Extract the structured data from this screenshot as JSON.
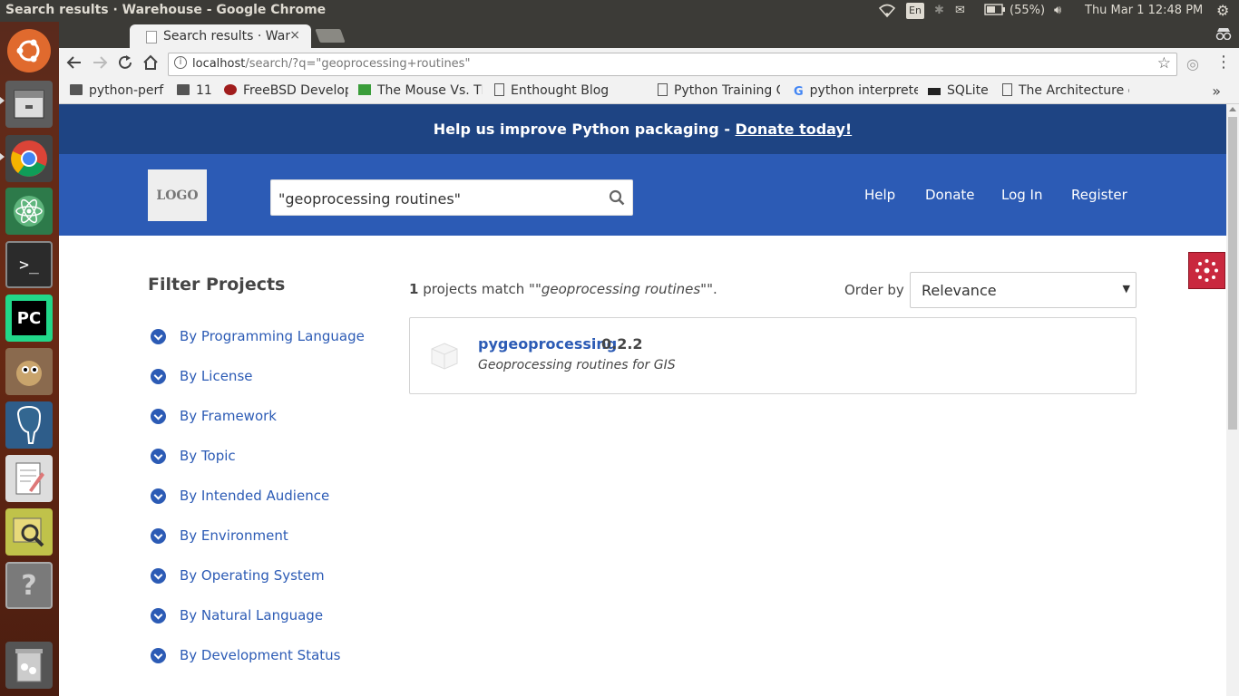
{
  "os": {
    "window_title": "Search results · Warehouse - Google Chrome",
    "keyboard": "En",
    "battery": "(55%)",
    "clock": "Thu Mar  1 12:48 PM"
  },
  "browser": {
    "tab_title": "Search results · Warehouse",
    "tab_close": "×",
    "url_host": "localhost",
    "url_path": "/search/?q=\"geoprocessing+routines\"",
    "bookmarks": [
      {
        "label": "python-perf",
        "icon": "folder-icon"
      },
      {
        "label": "11",
        "icon": "folder-icon"
      },
      {
        "label": "FreeBSD Developers' H",
        "icon": "freebsd-icon"
      },
      {
        "label": "The Mouse Vs. The Pyt",
        "icon": "python-icon"
      },
      {
        "label": "Enthought Blog",
        "icon": "page-icon"
      },
      {
        "label": "Python Training Cours",
        "icon": "page-icon"
      },
      {
        "label": "python interpreter - W",
        "icon": "google-icon"
      },
      {
        "label": "SQLite",
        "icon": "sqlite-icon"
      },
      {
        "label": "The Architecture of Op",
        "icon": "page-icon"
      }
    ],
    "bookmarks_more": "»"
  },
  "page": {
    "banner_text": "Help us improve Python packaging - ",
    "banner_link": "Donate today!",
    "logo": "LOGO",
    "search_value": "\"geoprocessing routines\"",
    "nav": {
      "help": "Help",
      "donate": "Donate",
      "login": "Log In",
      "register": "Register"
    },
    "filter_title": "Filter Projects",
    "filters": [
      "By Programming Language",
      "By License",
      "By Framework",
      "By Topic",
      "By Intended Audience",
      "By Environment",
      "By Operating System",
      "By Natural Language",
      "By Development Status"
    ],
    "results_count": "1",
    "results_text_prefix": " projects match \"",
    "results_query": "\"geoprocessing routines\"",
    "results_text_suffix": "\".",
    "order_label": "Order by",
    "order_value": "Relevance",
    "result": {
      "name": "pygeoprocessing",
      "version": "0.2.2",
      "description": "Geoprocessing routines for GIS"
    }
  }
}
